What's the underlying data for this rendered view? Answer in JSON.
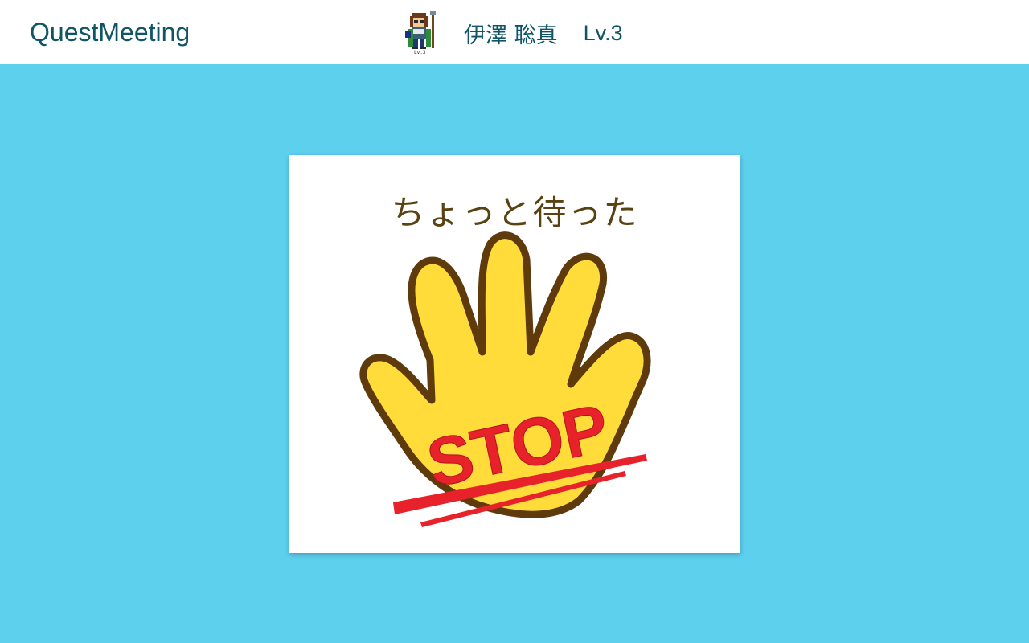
{
  "header": {
    "brand": "QuestMeeting",
    "user": {
      "avatar_label": "Lv.3",
      "name": "伊澤 聡真",
      "level": "Lv.3"
    }
  },
  "card": {
    "title": "ちょっと待った",
    "image_text": "STOP",
    "image_icon": "stop-hand-icon"
  },
  "colors": {
    "background": "#5dd0ee",
    "header": "#ffffff",
    "brand_text": "#0f5566",
    "card_title": "#5a4312",
    "hand_fill": "#ffdc3a",
    "hand_outline": "#5e3a0c",
    "stop_red": "#e8222a"
  }
}
